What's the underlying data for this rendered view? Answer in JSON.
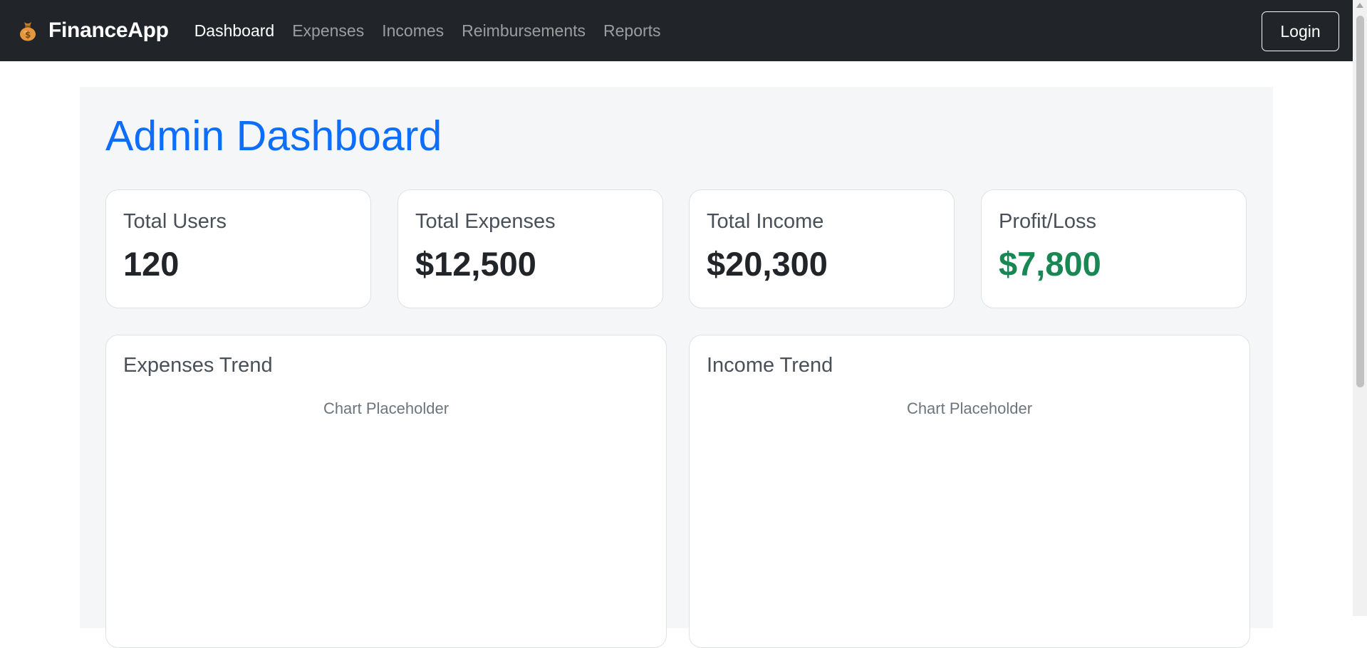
{
  "navbar": {
    "brand": "FinanceApp",
    "brand_icon": "money-bag-icon",
    "links": [
      {
        "label": "Dashboard",
        "active": true
      },
      {
        "label": "Expenses",
        "active": false
      },
      {
        "label": "Incomes",
        "active": false
      },
      {
        "label": "Reimbursements",
        "active": false
      },
      {
        "label": "Reports",
        "active": false
      }
    ],
    "login_label": "Login"
  },
  "page": {
    "title": "Admin Dashboard"
  },
  "stats": [
    {
      "label": "Total Users",
      "value": "120"
    },
    {
      "label": "Total Expenses",
      "value": "$12,500"
    },
    {
      "label": "Total Income",
      "value": "$20,300"
    },
    {
      "label": "Profit/Loss",
      "value": "$7,800"
    }
  ],
  "charts": [
    {
      "title": "Expenses Trend",
      "placeholder": "Chart Placeholder"
    },
    {
      "title": "Income Trend",
      "placeholder": "Chart Placeholder"
    }
  ],
  "colors": {
    "navbar_bg": "#212529",
    "accent": "#0d6efd",
    "positive": "#198754",
    "content_bg": "#f5f6f8"
  }
}
